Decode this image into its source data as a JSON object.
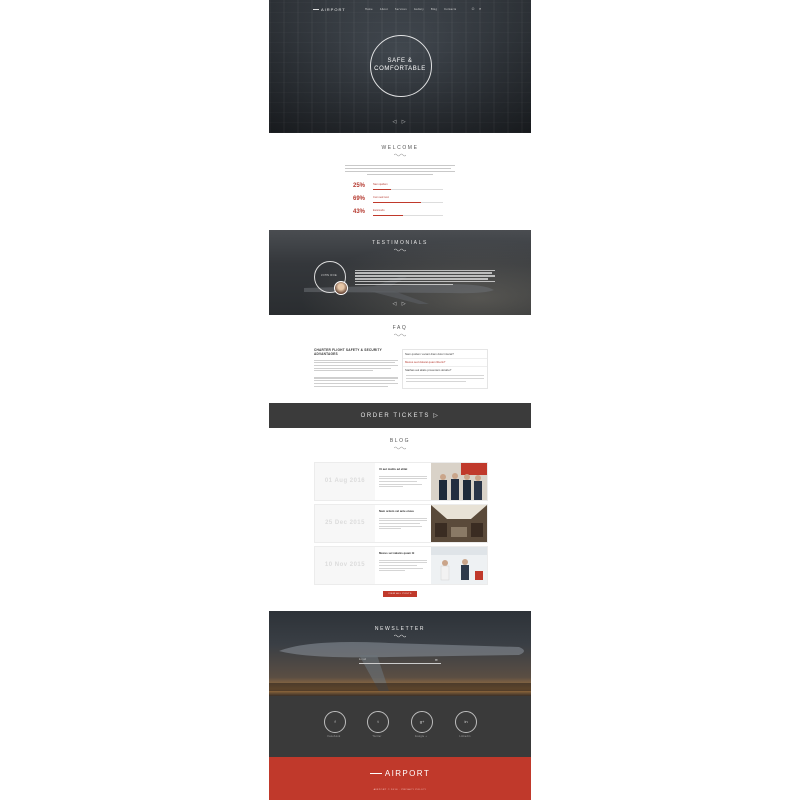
{
  "brand": {
    "name": "AIRPORT"
  },
  "nav": {
    "items": [
      "Home",
      "About",
      "Services",
      "Gallery",
      "Blog",
      "Contacts"
    ]
  },
  "hero": {
    "title_line1": "SAFE &",
    "title_line2": "COMFORTABLE",
    "arrows": "◁ ▷"
  },
  "welcome": {
    "title": "WELCOME",
    "stats": [
      {
        "percent": "25%",
        "label": "Nam quidem",
        "fill": 0.25
      },
      {
        "percent": "69%",
        "label": "Cum sed tunc",
        "fill": 0.69
      },
      {
        "percent": "43%",
        "label": "Euismodo",
        "fill": 0.43
      }
    ]
  },
  "testimonials": {
    "title": "TESTIMONIALS",
    "name": "JOHN DOE",
    "arrows": "◁ ▷"
  },
  "faq": {
    "title": "FAQ",
    "left_heading": "CHARTER FLIGHT SAFETY & SECURITY ADVANTAGES",
    "items": [
      "Nam quidem vocant diam dolor interat?",
      "Mecus sed dolorat quam liberis?",
      "Stathas aut alialo proveniam dorahe?"
    ]
  },
  "order": {
    "label": "ORDER TICKETS ▷"
  },
  "blog": {
    "title": "BLOG",
    "posts": [
      {
        "date": "01 Aug 2016",
        "title": "Ut aut mattis ad elitat"
      },
      {
        "date": "25 Dec 2015",
        "title": "Nam ordem vel ante etusa"
      },
      {
        "date": "10 Nov 2015",
        "title": "Mecus sel nalanis quam lit"
      }
    ],
    "view_all": "VIEW ALL POSTS"
  },
  "newsletter": {
    "title": "NEWSLETTER",
    "placeholder": "E-mail",
    "button": "✉"
  },
  "social": [
    {
      "icon": "f",
      "label": "Facebook"
    },
    {
      "icon": "t",
      "label": "Twitter"
    },
    {
      "icon": "g+",
      "label": "Google +"
    },
    {
      "icon": "in",
      "label": "Linkedin"
    }
  ],
  "footer": {
    "logo": "AIRPORT",
    "copy": "AIRPORT © 2016 · PRIVACY POLICY"
  },
  "colors": {
    "accent": "#c0392b",
    "dark": "#3b3b3b"
  }
}
